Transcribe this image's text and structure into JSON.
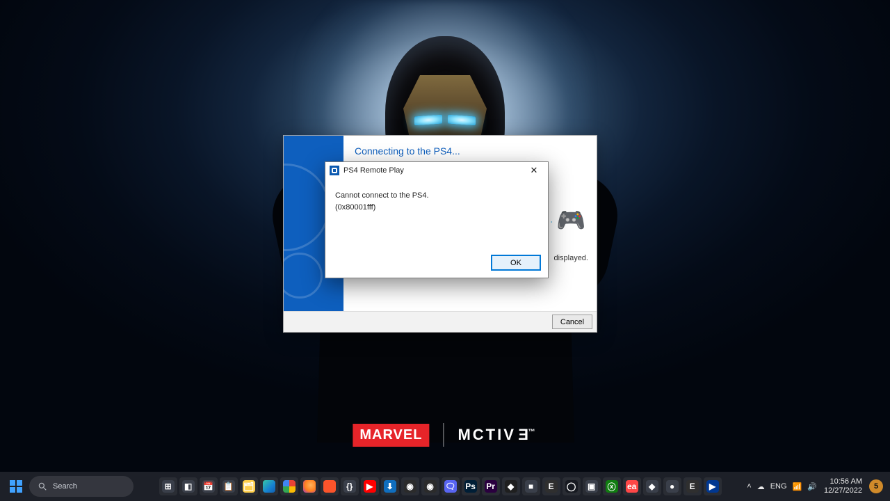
{
  "wallpaper": {
    "logo_left": "MARVEL",
    "logo_right_raw": "MCTIVE",
    "logo_right_trademark": "™"
  },
  "main_window": {
    "heading": "Connecting to the PS4...",
    "footer_caption_fragment": "displayed.",
    "cancel_label": "Cancel"
  },
  "error_dialog": {
    "title": "PS4 Remote Play",
    "message_line1": "Cannot connect to the PS4.",
    "message_line2": "(0x80001fff)",
    "ok_label": "OK"
  },
  "taskbar": {
    "search_placeholder": "Search",
    "apps": [
      {
        "name": "task-view",
        "glyph": "⊞",
        "cls": "c-generic"
      },
      {
        "name": "widgets",
        "glyph": "◧",
        "cls": "c-generic"
      },
      {
        "name": "calendar",
        "glyph": "📅",
        "cls": "c-generic"
      },
      {
        "name": "notes",
        "glyph": "📋",
        "cls": "c-generic"
      },
      {
        "name": "explorer",
        "glyph": "🗂",
        "cls": "c-exp"
      },
      {
        "name": "edge",
        "glyph": "",
        "cls": "c-edge"
      },
      {
        "name": "chrome",
        "glyph": "",
        "cls": "c-chr"
      },
      {
        "name": "firefox",
        "glyph": "",
        "cls": "c-ff"
      },
      {
        "name": "brave",
        "glyph": "",
        "cls": "c-brave"
      },
      {
        "name": "code",
        "glyph": "{}",
        "cls": "c-generic"
      },
      {
        "name": "youtube",
        "glyph": "▶",
        "cls": "c-yt"
      },
      {
        "name": "ms-store",
        "glyph": "⬇",
        "cls": "c-store"
      },
      {
        "name": "obs",
        "glyph": "◉",
        "cls": "c-obs"
      },
      {
        "name": "obs-2",
        "glyph": "◉",
        "cls": "c-obs"
      },
      {
        "name": "discord",
        "glyph": "🗨",
        "cls": "c-disc"
      },
      {
        "name": "photoshop",
        "glyph": "Ps",
        "cls": "c-ps"
      },
      {
        "name": "premiere",
        "glyph": "Pr",
        "cls": "c-pr"
      },
      {
        "name": "davinci",
        "glyph": "◆",
        "cls": "c-dv"
      },
      {
        "name": "app-1",
        "glyph": "■",
        "cls": "c-generic"
      },
      {
        "name": "epic",
        "glyph": "E",
        "cls": "c-epic"
      },
      {
        "name": "steam",
        "glyph": "◯",
        "cls": "c-steam"
      },
      {
        "name": "app-2",
        "glyph": "▣",
        "cls": "c-generic"
      },
      {
        "name": "xbox",
        "glyph": "ⓧ",
        "cls": "c-xbox"
      },
      {
        "name": "ea",
        "glyph": "ea",
        "cls": "c-ea"
      },
      {
        "name": "streamlabs",
        "glyph": "◆",
        "cls": "c-generic"
      },
      {
        "name": "app-3",
        "glyph": "●",
        "cls": "c-generic"
      },
      {
        "name": "epic-2",
        "glyph": "E",
        "cls": "c-epic"
      },
      {
        "name": "ps-remote",
        "glyph": "▶",
        "cls": "c-ps4"
      }
    ],
    "tray": {
      "chevron": "˄",
      "cloud": "☁",
      "lang": "ENG",
      "wifi": "📶",
      "vol": "🔊",
      "time": "10:56 AM",
      "date": "12/27/2022",
      "notif_count": "5"
    }
  }
}
